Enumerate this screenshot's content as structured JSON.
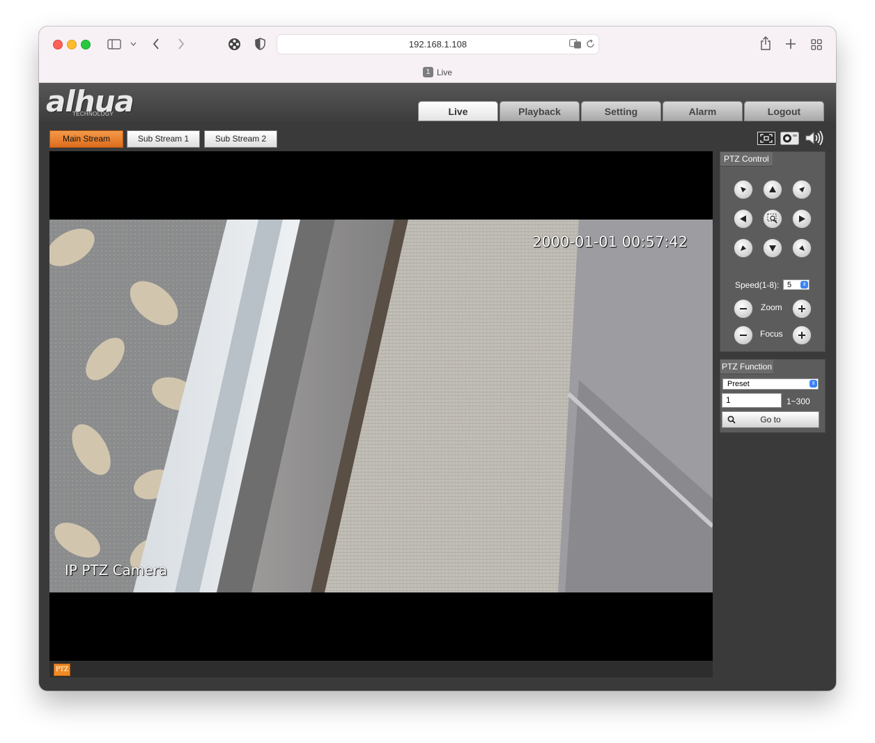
{
  "browser": {
    "url": "192.168.1.108",
    "tab_count": "1",
    "tab_title": "Live"
  },
  "brand": {
    "logo": "alhua",
    "tagline": "TECHNOLOGY"
  },
  "nav": {
    "tabs": [
      {
        "label": "Live",
        "active": true
      },
      {
        "label": "Playback"
      },
      {
        "label": "Setting"
      },
      {
        "label": "Alarm"
      },
      {
        "label": "Logout"
      }
    ]
  },
  "streams": {
    "main": "Main Stream",
    "sub1": "Sub Stream 1",
    "sub2": "Sub Stream 2",
    "active": "Main Stream"
  },
  "video": {
    "timestamp": "2000-01-01 00:57:42",
    "camera_name": "IP PTZ Camera",
    "ptz_badge": "PTZ"
  },
  "ptz_control": {
    "title": "PTZ Control",
    "speed_label": "Speed(1-8):",
    "speed_value": "5",
    "zoom_label": "Zoom",
    "focus_label": "Focus"
  },
  "ptz_function": {
    "title": "PTZ Function",
    "mode": "Preset",
    "preset_value": "1",
    "range": "1~300",
    "goto_label": "Go to"
  },
  "colors": {
    "active_stream": "#e8792b",
    "ptz_badge": "#f08a24"
  }
}
